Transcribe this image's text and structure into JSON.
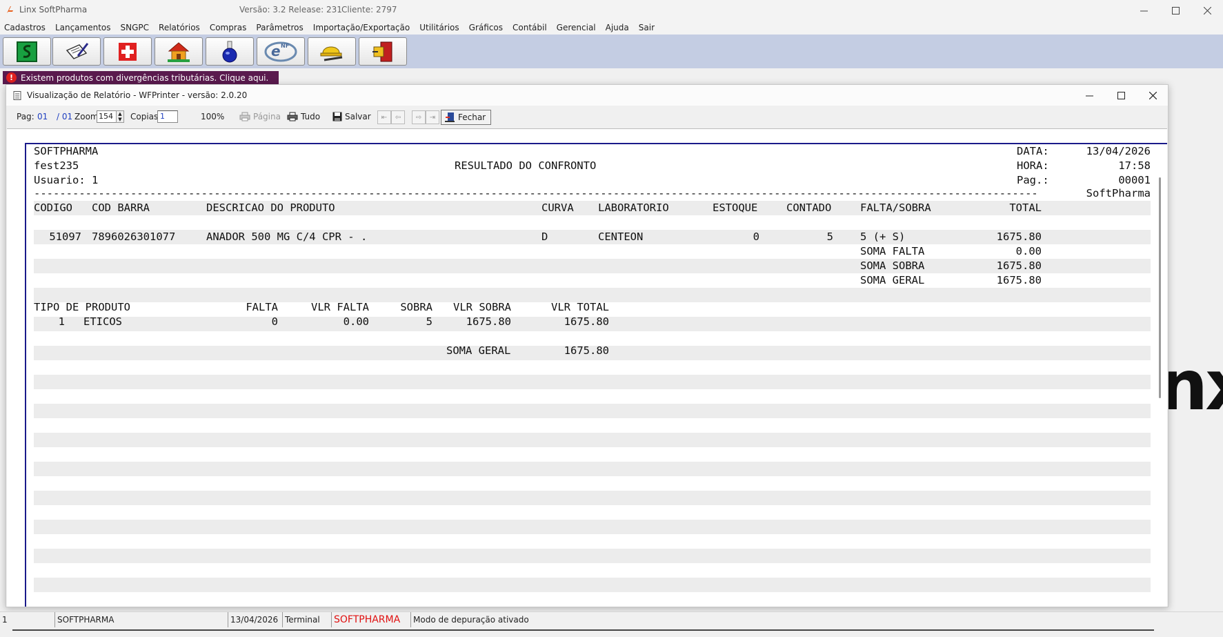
{
  "app": {
    "title": "Linx SoftPharma",
    "version": "Versão: 3.2 Release: 231",
    "client": "Cliente: 2797"
  },
  "menu": [
    "Cadastros",
    "Lançamentos",
    "SNGPC",
    "Relatórios",
    "Compras",
    "Parâmetros",
    "Importação/Exportação",
    "Utilitários",
    "Gráficos",
    "Contábil",
    "Gerencial",
    "Ajuda",
    "Sair"
  ],
  "toolbar_icons": [
    "cash-register-icon",
    "notepad-pen-icon",
    "pharmacy-cross-icon",
    "house-icon",
    "flask-icon",
    "nfe-icon",
    "hardhat-tools-icon",
    "exit-door-icon"
  ],
  "alert": {
    "text": "Existem produtos com divergências tributárias. Clique aqui.",
    "icon": "!"
  },
  "background_logo_text": "nx",
  "report_window": {
    "title": "Visualização de Relatório - WFPrinter - versão: 2.0.20",
    "toolbar": {
      "pag_label": "Pag:",
      "page_current": "01",
      "page_total": "/ 01",
      "zoom_label": "Zoom:",
      "zoom_value": "154",
      "copies_label": "Copias",
      "copies_value": "1",
      "zoom_percent": "100%",
      "pagina_label": "Página",
      "tudo_label": "Tudo",
      "salvar_label": "Salvar",
      "fechar_label": "Fechar"
    }
  },
  "report": {
    "company": "SOFTPHARMA",
    "data_label": "DATA:",
    "data_value": "13/04/2026",
    "user_code": "fest235",
    "title": "RESULTADO DO CONFRONTO",
    "hora_label": "HORA:",
    "hora_value": "17:58",
    "usuario": "Usuario: 1",
    "pag_label": "Pag.:",
    "pag_value": "00001",
    "separator_brand": "SoftPharma",
    "headers": {
      "codigo": "CODIGO",
      "cod_barra": "COD BARRA",
      "descricao": "DESCRICAO DO PRODUTO",
      "curva": "CURVA",
      "laboratorio": "LABORATORIO",
      "estoque": "ESTOQUE",
      "contado": "CONTADO",
      "falta_sobra": "FALTA/SOBRA",
      "total": "TOTAL"
    },
    "rows": [
      {
        "codigo": "51097",
        "cod_barra": "7896026301077",
        "descricao": "ANADOR 500 MG C/4 CPR - .",
        "curva": "D",
        "laboratorio": "CENTEON",
        "estoque": "0",
        "contado": "5",
        "falta_sobra": "5 (+ S)",
        "total": "1675.80"
      }
    ],
    "sums": {
      "soma_falta_label": "SOMA FALTA",
      "soma_falta": "0.00",
      "soma_sobra_label": "SOMA SOBRA",
      "soma_sobra": "1675.80",
      "soma_geral_label": "SOMA GERAL",
      "soma_geral": "1675.80"
    },
    "tipo_headers": {
      "tipo": "TIPO DE PRODUTO",
      "falta": "FALTA",
      "vlr_falta": "VLR FALTA",
      "sobra": "SOBRA",
      "vlr_sobra": "VLR SOBRA",
      "vlr_total": "VLR TOTAL"
    },
    "tipo_rows": [
      {
        "num": "1",
        "tipo": "ETICOS",
        "falta": "0",
        "vlr_falta": "0.00",
        "sobra": "5",
        "vlr_sobra": "1675.80",
        "vlr_total": "1675.80"
      }
    ],
    "final_label": "SOMA GERAL",
    "final_value": "1675.80"
  },
  "statusbar": {
    "num": "1",
    "company": "SOFTPHARMA",
    "date": "13/04/2026",
    "terminal": "Terminal",
    "brand": "SOFTPHARMA",
    "mode": "Modo de depuração ativado"
  },
  "colors": {
    "toolbar_band": "#c4cde3",
    "alert_bg": "#5a1a4e",
    "alert_icon": "#e02020",
    "page_border": "#1a1a8a",
    "stripe": "#ececec",
    "link_blue": "#2040c0",
    "status_brand": "#e01010"
  }
}
